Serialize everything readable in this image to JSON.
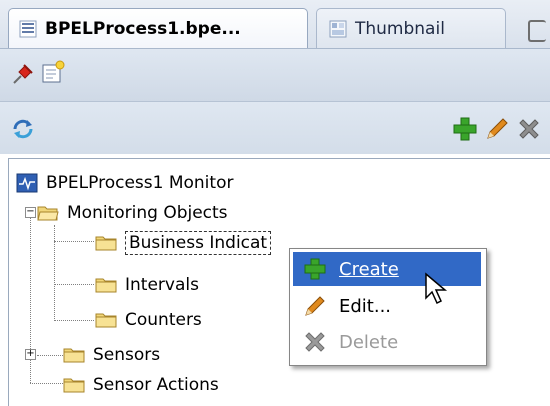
{
  "tabs": [
    {
      "label": "BPELProcess1.bpe...",
      "active": true,
      "icon": "process-diagram-icon"
    },
    {
      "label": "Thumbnail",
      "active": false,
      "icon": "thumbnail-icon"
    }
  ],
  "toolbar1": {
    "icons": [
      "pin-icon",
      "edit-document-icon"
    ]
  },
  "toolbar2": {
    "icons": [
      "refresh-icon",
      "add-icon",
      "edit-pencil-icon",
      "delete-x-icon"
    ]
  },
  "tree": {
    "root": "BPELProcess1 Monitor",
    "monitoring_objects": "Monitoring Objects",
    "business_indicators": "Business Indicat",
    "intervals": "Intervals",
    "counters": "Counters",
    "sensors": "Sensors",
    "sensor_actions": "Sensor Actions"
  },
  "context_menu": {
    "items": [
      {
        "label": "Create",
        "icon": "add-icon",
        "state": "highlighted"
      },
      {
        "label": "Edit...",
        "icon": "edit-pencil-icon",
        "state": "enabled"
      },
      {
        "label": "Delete",
        "icon": "delete-x-icon",
        "state": "disabled"
      }
    ]
  },
  "colors": {
    "highlight": "#3169c6",
    "add_green": "#3aa52b",
    "pencil_orange": "#e08a1e"
  }
}
